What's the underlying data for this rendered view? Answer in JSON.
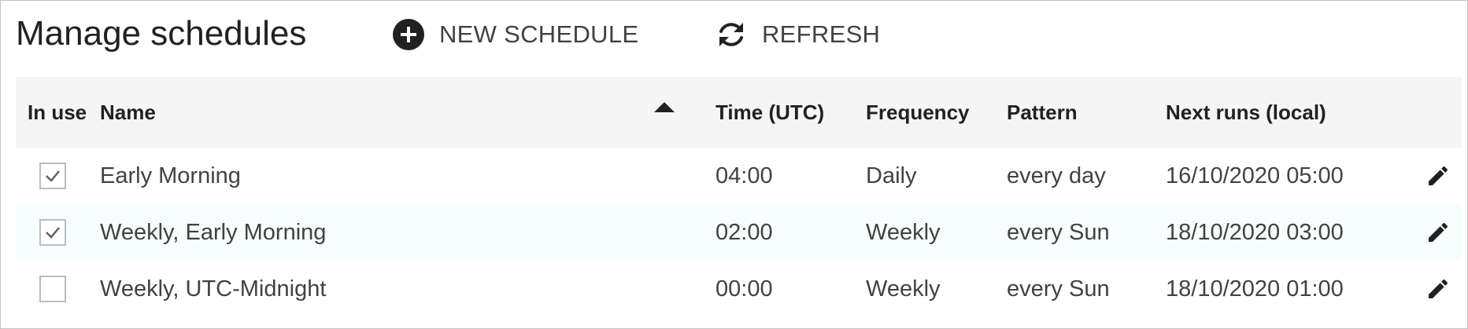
{
  "header": {
    "title": "Manage schedules",
    "new_label": "NEW SCHEDULE",
    "refresh_label": "REFRESH"
  },
  "table": {
    "columns": {
      "in_use": "In use",
      "name": "Name",
      "time": "Time (UTC)",
      "frequency": "Frequency",
      "pattern": "Pattern",
      "next_runs": "Next runs (local)"
    },
    "sort": {
      "column": "name",
      "direction": "ascending"
    },
    "rows": [
      {
        "in_use": true,
        "name": "Early Morning",
        "time": "04:00",
        "frequency": "Daily",
        "pattern": "every day",
        "next_runs": "16/10/2020 05:00"
      },
      {
        "in_use": true,
        "name": "Weekly, Early Morning",
        "time": "02:00",
        "frequency": "Weekly",
        "pattern": "every Sun",
        "next_runs": "18/10/2020 03:00"
      },
      {
        "in_use": false,
        "name": "Weekly, UTC-Midnight",
        "time": "00:00",
        "frequency": "Weekly",
        "pattern": "every Sun",
        "next_runs": "18/10/2020 01:00"
      }
    ]
  },
  "icons": {
    "new": "add-circle-icon",
    "refresh": "refresh-icon",
    "sort": "sort-ascending-icon",
    "checkbox": "checkbox-icon",
    "edit": "pencil-icon"
  },
  "colors": {
    "header_bg": "#f5f5f5",
    "alt_row_bg": "#f7fdfd",
    "text": "#212121",
    "icon": "#212121",
    "checkbox_border": "#bdbdbd"
  }
}
